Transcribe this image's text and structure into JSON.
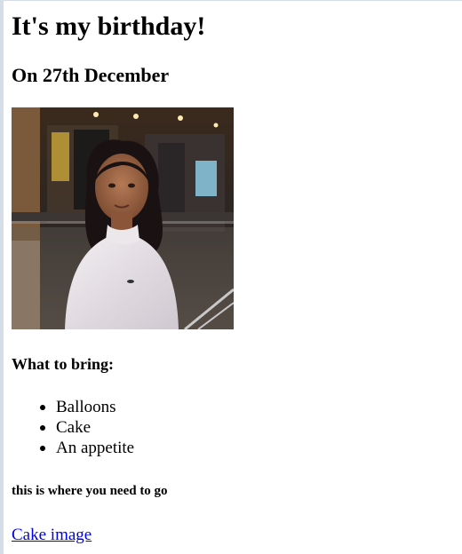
{
  "heading": "It's my birthday!",
  "subheading": "On 27th December",
  "photo": {
    "alt": "Portrait photo of a woman in a white sweater"
  },
  "bring_heading": "What to bring:",
  "bring_items": [
    "Balloons",
    "Cake",
    "An appetite"
  ],
  "directions_text": "this is where you need to go",
  "link_text": "Cake image",
  "colors": {
    "link": "#0000ee",
    "text": "#000000",
    "background": "#ffffff"
  }
}
